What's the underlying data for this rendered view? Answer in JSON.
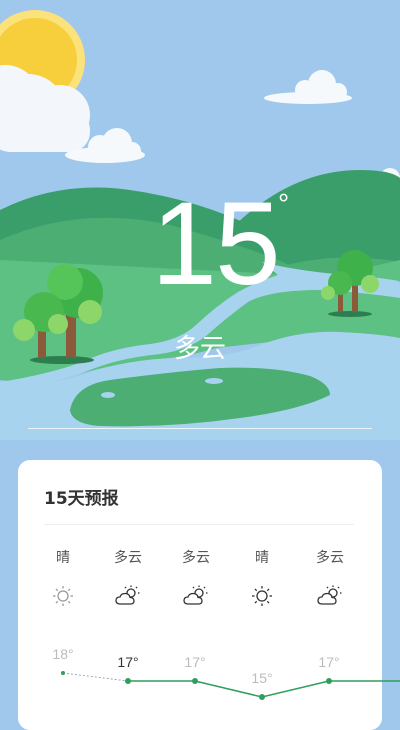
{
  "current": {
    "temperature": "15",
    "degree_symbol": "°",
    "condition": "多云"
  },
  "forecast": {
    "title": "15天预报",
    "days": [
      {
        "condition": "晴",
        "icon": "sun-icon",
        "temp": "18°"
      },
      {
        "condition": "多云",
        "icon": "partly-cloudy-icon",
        "temp": "17°"
      },
      {
        "condition": "多云",
        "icon": "partly-cloudy-icon",
        "temp": "17°"
      },
      {
        "condition": "晴",
        "icon": "sun-icon",
        "temp": "15°"
      },
      {
        "condition": "多云",
        "icon": "partly-cloudy-icon",
        "temp": "17°"
      }
    ]
  },
  "colors": {
    "sky": "#9fc8ec",
    "hill_dark": "#3a9e6b",
    "hill_light": "#5cc183",
    "river": "#a7d3ee",
    "line_active": "#2e9e5b",
    "line_past": "#9ab"
  }
}
